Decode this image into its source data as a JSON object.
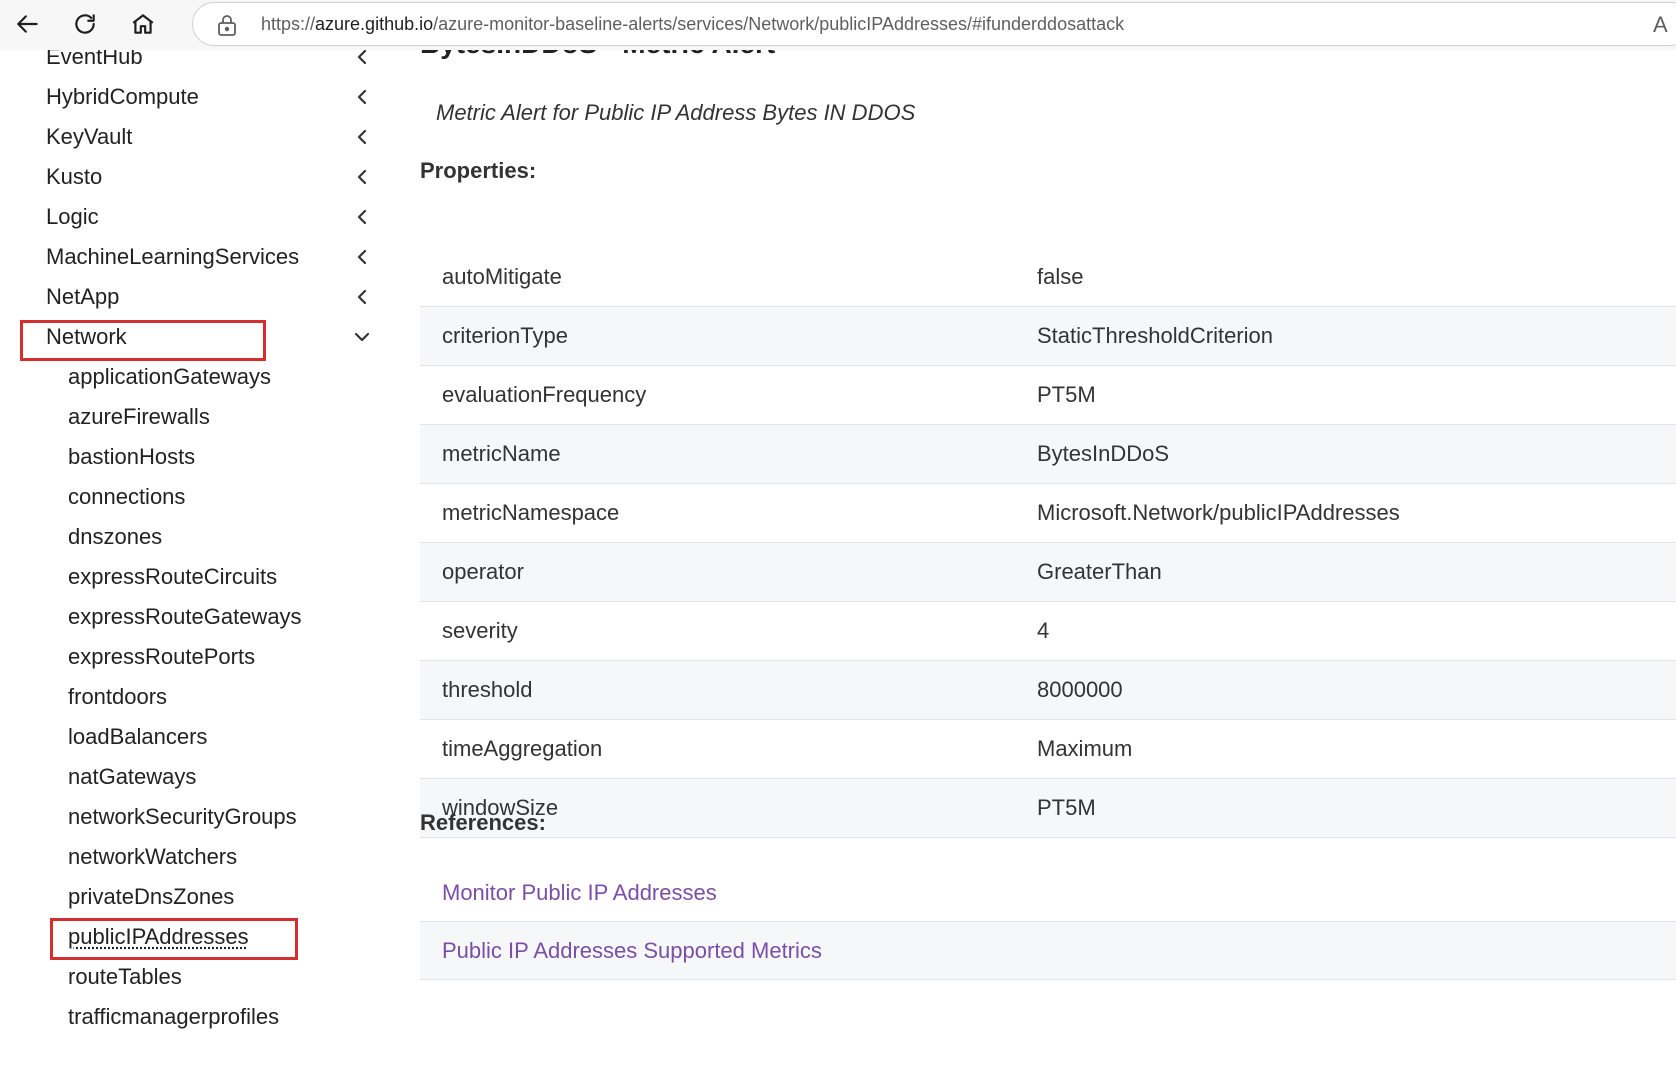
{
  "browser": {
    "url_scheme": "https://",
    "url_host": "azure.github.io",
    "url_path": "/azure-monitor-baseline-alerts/services/Network/publicIPAddresses/#ifunderddosattack",
    "trailing_glyph": "A"
  },
  "sidebar": {
    "top_items": [
      {
        "label": "EventHub"
      },
      {
        "label": "HybridCompute"
      },
      {
        "label": "KeyVault"
      },
      {
        "label": "Kusto"
      },
      {
        "label": "Logic"
      },
      {
        "label": "MachineLearningServices"
      },
      {
        "label": "NetApp"
      },
      {
        "label": "Network",
        "expanded": true
      }
    ],
    "sub_items": [
      {
        "label": "applicationGateways"
      },
      {
        "label": "azureFirewalls"
      },
      {
        "label": "bastionHosts"
      },
      {
        "label": "connections"
      },
      {
        "label": "dnszones"
      },
      {
        "label": "expressRouteCircuits"
      },
      {
        "label": "expressRouteGateways"
      },
      {
        "label": "expressRoutePorts"
      },
      {
        "label": "frontdoors"
      },
      {
        "label": "loadBalancers"
      },
      {
        "label": "natGateways"
      },
      {
        "label": "networkSecurityGroups"
      },
      {
        "label": "networkWatchers"
      },
      {
        "label": "privateDnsZones"
      },
      {
        "label": "publicIPAddresses",
        "current": true
      },
      {
        "label": "routeTables"
      },
      {
        "label": "trafficmanagerprofiles"
      }
    ],
    "highlight_color": "#d32f2f"
  },
  "content": {
    "title": "BytesInDDoS - Metric Alert",
    "description": "Metric Alert for Public IP Address Bytes IN DDOS",
    "properties_heading": "Properties:",
    "properties": [
      {
        "key": "autoMitigate",
        "value": "false"
      },
      {
        "key": "criterionType",
        "value": "StaticThresholdCriterion"
      },
      {
        "key": "evaluationFrequency",
        "value": "PT5M"
      },
      {
        "key": "metricName",
        "value": "BytesInDDoS"
      },
      {
        "key": "metricNamespace",
        "value": "Microsoft.Network/publicIPAddresses"
      },
      {
        "key": "operator",
        "value": "GreaterThan"
      },
      {
        "key": "severity",
        "value": "4"
      },
      {
        "key": "threshold",
        "value": "8000000"
      },
      {
        "key": "timeAggregation",
        "value": "Maximum"
      },
      {
        "key": "windowSize",
        "value": "PT5M"
      }
    ],
    "references_heading": "References:",
    "references": [
      {
        "label": "Monitor Public IP Addresses"
      },
      {
        "label": "Public IP Addresses Supported Metrics"
      }
    ],
    "link_color": "#7a4fa8"
  }
}
